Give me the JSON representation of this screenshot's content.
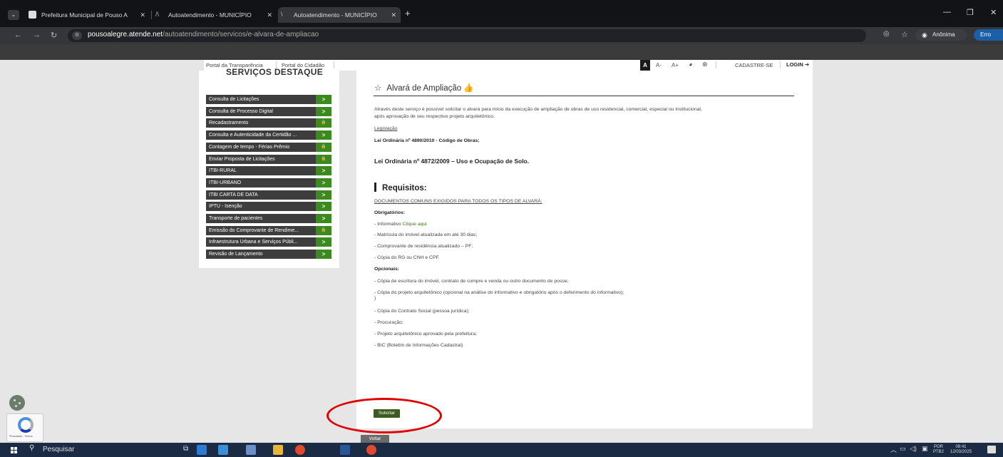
{
  "browser": {
    "tabs": [
      {
        "title": "Prefeitura Municipal de Pouso A"
      },
      {
        "title": "Autoatendimento - MUNICÍPIO"
      },
      {
        "title": "Autoatendimento - MUNICÍPIO"
      }
    ],
    "url_host": "pousoalegre.atende.net",
    "url_path": "/autoatendimento/servicos/e-alvara-de-ampliacao",
    "incognito_label": "Anônima",
    "error_label": "Erro"
  },
  "topnav": {
    "transparencia": "Portal da Transparência",
    "cidadao": "Portal do Cidadão",
    "font_normal": "A",
    "font_minus": "A-",
    "font_plus": "A+",
    "cadastre": "CADASTRE-SE",
    "login": "LOGIN"
  },
  "sidebar": {
    "title": "SERVIÇOS DESTAQUE",
    "items": [
      {
        "label": "Consulta de Licitações",
        "icon": ">"
      },
      {
        "label": "Consulta de Processo Digital",
        "icon": ">"
      },
      {
        "label": "Recadastramento",
        "icon": "lock"
      },
      {
        "label": "Consulta e Autenticidade da Certidão ...",
        "icon": ">"
      },
      {
        "label": "Contagem de tempo - Férias Prêmio",
        "icon": "lock"
      },
      {
        "label": "Enviar Proposta de Licitações",
        "icon": "lock"
      },
      {
        "label": "ITBI-RURAL",
        "icon": ">"
      },
      {
        "label": "ITBI-URBANO",
        "icon": ">"
      },
      {
        "label": "ITBI CARTA DE DATA",
        "icon": ">"
      },
      {
        "label": "IPTU - Isenção",
        "icon": ">"
      },
      {
        "label": "Transporte de pacientes",
        "icon": ">"
      },
      {
        "label": "Emissão do Comprovante de Rendime...",
        "icon": "lock"
      },
      {
        "label": "Infraestrutura Urbana e Serviços Públi...",
        "icon": ">"
      },
      {
        "label": "Revisão de Lançamento",
        "icon": ">"
      }
    ]
  },
  "content": {
    "title": "Alvará de Ampliação",
    "intro1": "Através deste serviço é possível solicitar o alvará para início da execução de ampliação de obras de uso residencial, comercial, especial ou institucional,",
    "intro2": "após aprovação de seu respectivo projeto arquitetônico.",
    "legislacao": "Legislação",
    "lei1": "Lei Ordinária nº 4890/2010 - Código de Obras;",
    "lei2": "Lei Ordinária nº 4872/2009 – Uso e Ocupação de Solo.",
    "requisitos": "Requisitos:",
    "docs_comuns": "DOCUMENTOS COMUNS EXIGIDOS PARA TODOS OS TIPOS DE ALVARÁ:",
    "obrigatorios": "Obrigatórios:",
    "informativo_prefix": "- Informativo ",
    "informativo_link": "Clique aqui",
    "obr": [
      "- Matrícula do imóvel atualizada em até 30 dias;",
      "- Comprovante de residência atualizado – PF;",
      "- Cópia do RG ou CNH e CPF."
    ],
    "opcionais": "Opcionais:",
    "op1": " - Cópia de escritura do imóvel, contrato de compre e venda ou outro documento de posse;",
    "op2": "- Cópia do projeto arquitetônico (opcional na análise do informativo e obrigatório após o deferimento do informativo);",
    "op2b": ")",
    "op3": "- Cópia do Contrato Social (pessoa jurídica);",
    "op4": "- Procuração;",
    "op5": "- Projeto arquitetônico aprovado pela prefeitura;",
    "op6": "- BIC (Boletim de Informações Cadastral)",
    "solicitar": "Solicitar",
    "voltar": "Voltar"
  },
  "recaptcha": {
    "privacy": "Privacidade - Termos"
  },
  "taskbar": {
    "search": "Pesquisar",
    "lang": "POR",
    "lang2": "PTB2",
    "time": "08:41",
    "date": "12/03/2025"
  },
  "colors": {
    "accent_green": "#3a8a1e",
    "sidebar_bg": "#3d3d3d",
    "highlight": "#e00000"
  }
}
